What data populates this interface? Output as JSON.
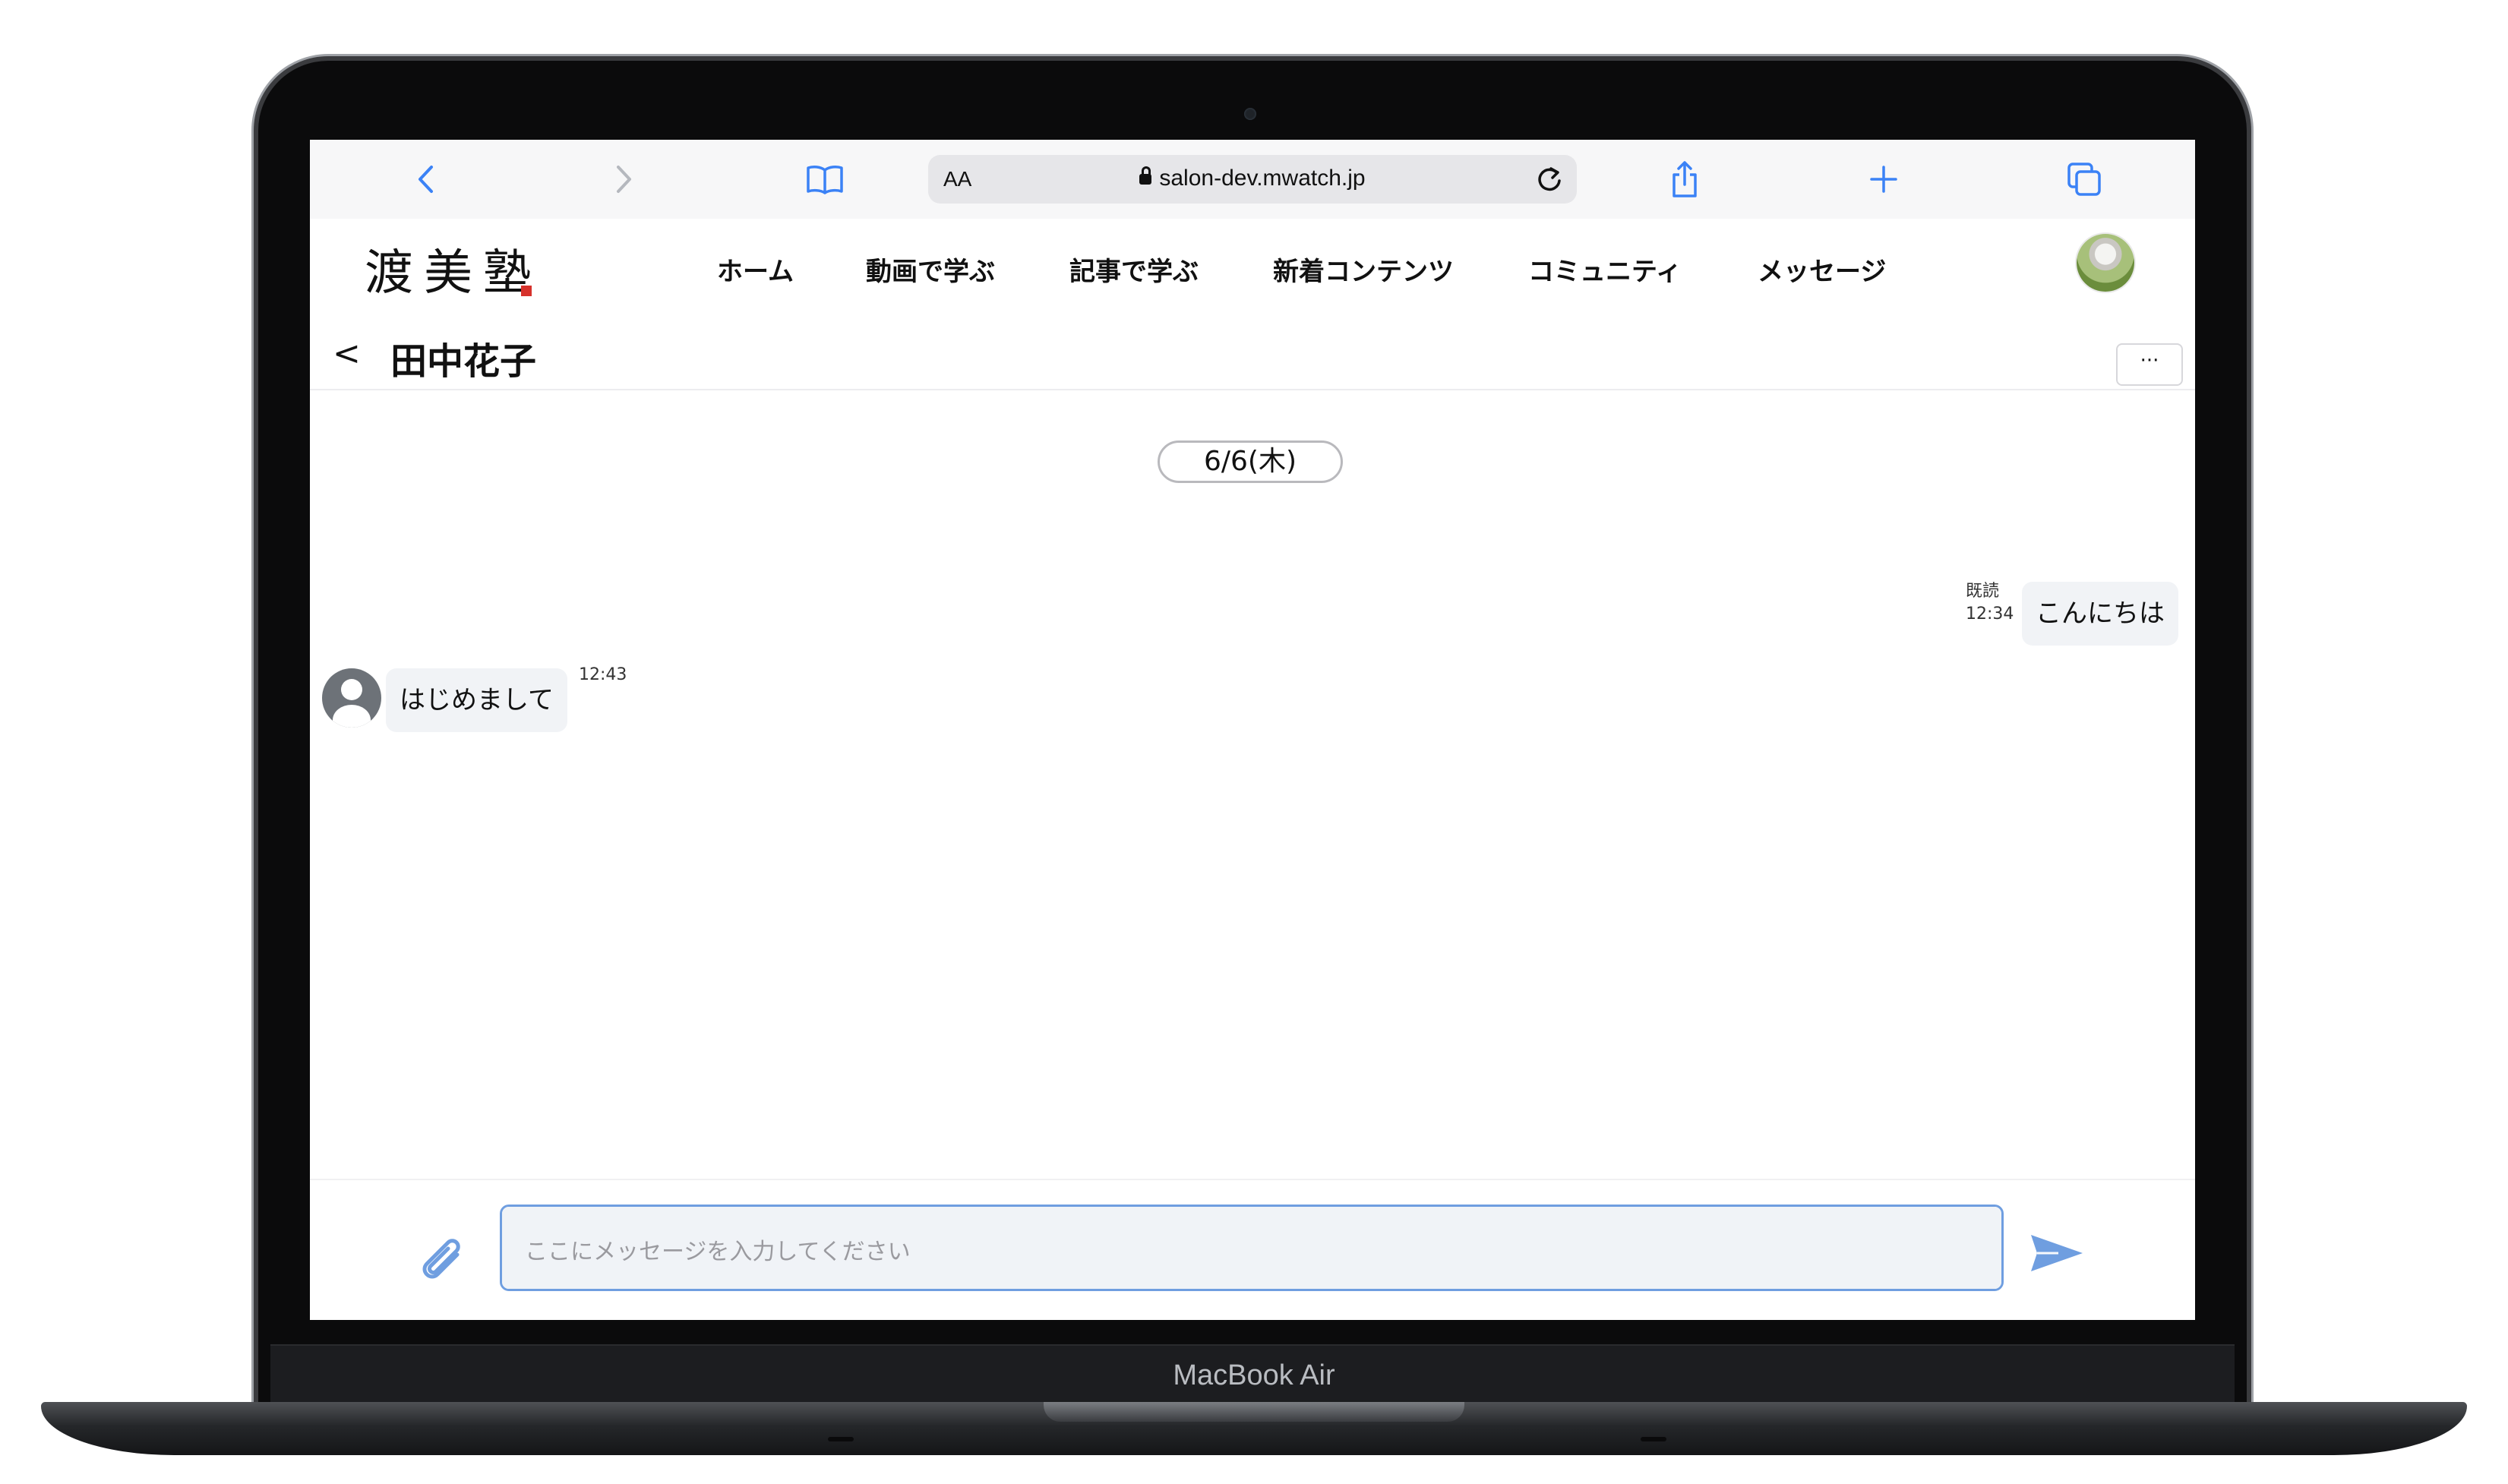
{
  "device": {
    "model_label": "MacBook Air"
  },
  "browser": {
    "address_text_size_label": "AA",
    "url": "salon-dev.mwatch.jp",
    "icons": [
      "back-icon",
      "forward-icon",
      "bookmarks-icon",
      "lock-icon",
      "reload-icon",
      "share-icon",
      "new-tab-icon",
      "tabs-icon"
    ]
  },
  "site": {
    "logo_text": "渡美塾",
    "nav": [
      "ホーム",
      "動画で学ぶ",
      "記事で学ぶ",
      "新着コンテンツ",
      "コミュニティ",
      "メッセージ"
    ]
  },
  "chat": {
    "back_label": "<",
    "title": "田中花子",
    "more_label": "···",
    "date_divider": "6/6(木)",
    "messages": [
      {
        "side": "right",
        "text": "こんにちは",
        "read_label": "既読",
        "time": "12:34"
      },
      {
        "side": "left",
        "text": "はじめまして",
        "time": "12:43"
      }
    ]
  },
  "composer": {
    "placeholder": "ここにメッセージを入力してください"
  },
  "colors": {
    "accent": "#4a7fd8",
    "bubble": "#f1f3f6",
    "input_border": "#6f9ee0"
  }
}
